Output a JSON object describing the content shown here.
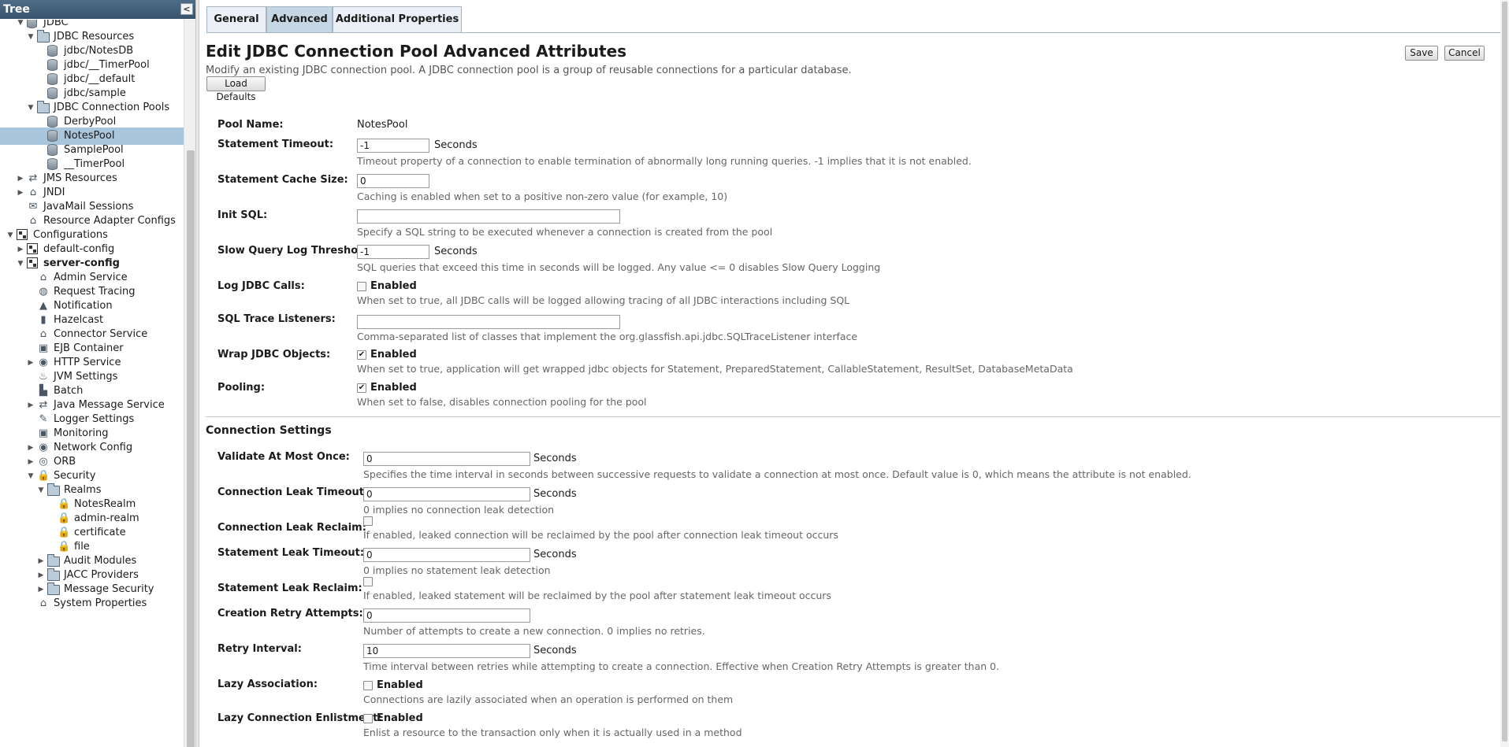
{
  "tree": {
    "header": "Tree",
    "collapse_glyph": "<",
    "items": [
      {
        "label": "JDBC",
        "expander": "▼",
        "icon": "database-icon"
      },
      {
        "label": "JDBC Resources",
        "expander": "▼",
        "icon": "folder-icon"
      },
      {
        "label": "jdbc/NotesDB",
        "expander": "",
        "icon": "database-icon"
      },
      {
        "label": "jdbc/__TimerPool",
        "expander": "",
        "icon": "database-icon"
      },
      {
        "label": "jdbc/__default",
        "expander": "",
        "icon": "database-icon"
      },
      {
        "label": "jdbc/sample",
        "expander": "",
        "icon": "database-icon"
      },
      {
        "label": "JDBC Connection Pools",
        "expander": "▼",
        "icon": "folder-icon"
      },
      {
        "label": "DerbyPool",
        "expander": "",
        "icon": "database-icon"
      },
      {
        "label": "NotesPool",
        "expander": "",
        "icon": "database-icon",
        "selected": true
      },
      {
        "label": "SamplePool",
        "expander": "",
        "icon": "database-icon"
      },
      {
        "label": "__TimerPool",
        "expander": "",
        "icon": "database-icon"
      },
      {
        "label": "JMS Resources",
        "expander": "▶",
        "icon": "jms-icon"
      },
      {
        "label": "JNDI",
        "expander": "▶",
        "icon": "jndi-icon"
      },
      {
        "label": "JavaMail Sessions",
        "expander": "",
        "icon": "mail-icon"
      },
      {
        "label": "Resource Adapter Configs",
        "expander": "",
        "icon": "adapter-icon"
      },
      {
        "label": "Configurations",
        "expander": "▼",
        "icon": "config-icon"
      },
      {
        "label": "default-config",
        "expander": "▶",
        "icon": "config-icon"
      },
      {
        "label": "server-config",
        "expander": "▼",
        "icon": "config-icon",
        "bold": true
      },
      {
        "label": "Admin Service",
        "expander": "",
        "icon": "admin-service-icon"
      },
      {
        "label": "Request Tracing",
        "expander": "",
        "icon": "magnifier-icon"
      },
      {
        "label": "Notification",
        "expander": "",
        "icon": "bell-icon"
      },
      {
        "label": "Hazelcast",
        "expander": "",
        "icon": "hazelcast-icon"
      },
      {
        "label": "Connector Service",
        "expander": "",
        "icon": "connector-icon"
      },
      {
        "label": "EJB Container",
        "expander": "",
        "icon": "ejb-icon"
      },
      {
        "label": "HTTP Service",
        "expander": "▶",
        "icon": "http-icon"
      },
      {
        "label": "JVM Settings",
        "expander": "",
        "icon": "java-icon"
      },
      {
        "label": "Batch",
        "expander": "",
        "icon": "batch-icon"
      },
      {
        "label": "Java Message Service",
        "expander": "▶",
        "icon": "jms-icon"
      },
      {
        "label": "Logger Settings",
        "expander": "",
        "icon": "logger-icon"
      },
      {
        "label": "Monitoring",
        "expander": "",
        "icon": "monitor-icon"
      },
      {
        "label": "Network Config",
        "expander": "▶",
        "icon": "network-icon"
      },
      {
        "label": "ORB",
        "expander": "▶",
        "icon": "orb-icon"
      },
      {
        "label": "Security",
        "expander": "▼",
        "icon": "lock-icon"
      },
      {
        "label": "Realms",
        "expander": "▼",
        "icon": "folder-icon"
      },
      {
        "label": "NotesRealm",
        "expander": "",
        "icon": "lock-icon"
      },
      {
        "label": "admin-realm",
        "expander": "",
        "icon": "lock-icon"
      },
      {
        "label": "certificate",
        "expander": "",
        "icon": "lock-icon"
      },
      {
        "label": "file",
        "expander": "",
        "icon": "lock-icon"
      },
      {
        "label": "Audit Modules",
        "expander": "▶",
        "icon": "folder-icon"
      },
      {
        "label": "JACC Providers",
        "expander": "▶",
        "icon": "folder-icon"
      },
      {
        "label": "Message Security",
        "expander": "▶",
        "icon": "folder-icon"
      },
      {
        "label": "System Properties",
        "expander": "",
        "icon": "properties-icon"
      }
    ]
  },
  "tabs": [
    "General",
    "Advanced",
    "Additional Properties"
  ],
  "page": {
    "title": "Edit JDBC Connection Pool Advanced Attributes",
    "description": "Modify an existing JDBC connection pool. A JDBC connection pool is a group of reusable connections for a particular database.",
    "load_defaults": "Load Defaults",
    "save": "Save",
    "cancel": "Cancel"
  },
  "form": {
    "pool_name": {
      "label": "Pool Name:",
      "value": "NotesPool"
    },
    "statement_timeout": {
      "label": "Statement Timeout:",
      "value": "-1",
      "unit": "Seconds",
      "help": "Timeout property of a connection to enable termination of abnormally long running queries. -1 implies that it is not enabled."
    },
    "statement_cache_size": {
      "label": "Statement Cache Size:",
      "value": "0",
      "help": "Caching is enabled when set to a positive non-zero value (for example, 10)"
    },
    "init_sql": {
      "label": "Init SQL:",
      "value": "",
      "help": "Specify a SQL string to be executed whenever a connection is created from the pool"
    },
    "slow_query": {
      "label": "Slow Query Log Threshold:",
      "value": "-1",
      "unit": "Seconds",
      "help": "SQL queries that exceed this time in seconds will be logged. Any value <= 0 disables Slow Query Logging"
    },
    "log_jdbc_calls": {
      "label": "Log JDBC Calls:",
      "checked": false,
      "check_label": "Enabled",
      "help": "When set to true, all JDBC calls will be logged allowing tracing of all JDBC interactions including SQL"
    },
    "sql_trace_listeners": {
      "label": "SQL Trace Listeners:",
      "value": "",
      "help": "Comma-separated list of classes that implement the org.glassfish.api.jdbc.SQLTraceListener interface"
    },
    "wrap_jdbc_objects": {
      "label": "Wrap JDBC Objects:",
      "checked": true,
      "check_label": "Enabled",
      "help": "When set to true, application will get wrapped jdbc objects for Statement, PreparedStatement, CallableStatement, ResultSet, DatabaseMetaData"
    },
    "pooling": {
      "label": "Pooling:",
      "checked": true,
      "check_label": "Enabled",
      "help": "When set to false, disables connection pooling for the pool"
    }
  },
  "connection_settings": {
    "title": "Connection Settings",
    "validate_at_most_once": {
      "label": "Validate At Most Once:",
      "value": "0",
      "unit": "Seconds",
      "help": "Specifies the time interval in seconds between successive requests to validate a connection at most once. Default value is 0, which means the attribute is not enabled."
    },
    "connection_leak_timeout": {
      "label": "Connection Leak Timeout:",
      "value": "0",
      "unit": "Seconds",
      "help": "0 implies no connection leak detection"
    },
    "connection_leak_reclaim": {
      "label": "Connection Leak Reclaim:",
      "checked": false,
      "help": "If enabled, leaked connection will be reclaimed by the pool after connection leak timeout occurs"
    },
    "statement_leak_timeout": {
      "label": "Statement Leak Timeout:",
      "value": "0",
      "unit": "Seconds",
      "help": "0 implies no statement leak detection"
    },
    "statement_leak_reclaim": {
      "label": "Statement Leak Reclaim:",
      "checked": false,
      "help": "If enabled, leaked statement will be reclaimed by the pool after statement leak timeout occurs"
    },
    "creation_retry_attempts": {
      "label": "Creation Retry Attempts:",
      "value": "0",
      "help": "Number of attempts to create a new connection. 0 implies no retries."
    },
    "retry_interval": {
      "label": "Retry Interval:",
      "value": "10",
      "unit": "Seconds",
      "help": "Time interval between retries while attempting to create a connection. Effective when Creation Retry Attempts is greater than 0."
    },
    "lazy_association": {
      "label": "Lazy Association:",
      "checked": false,
      "check_label": "Enabled",
      "help": "Connections are lazily associated when an operation is performed on them"
    },
    "lazy_enlistment": {
      "label": "Lazy Connection Enlistment:",
      "checked": false,
      "check_label": "Enabled",
      "help": "Enlist a resource to the transaction only when it is actually used in a method"
    }
  }
}
